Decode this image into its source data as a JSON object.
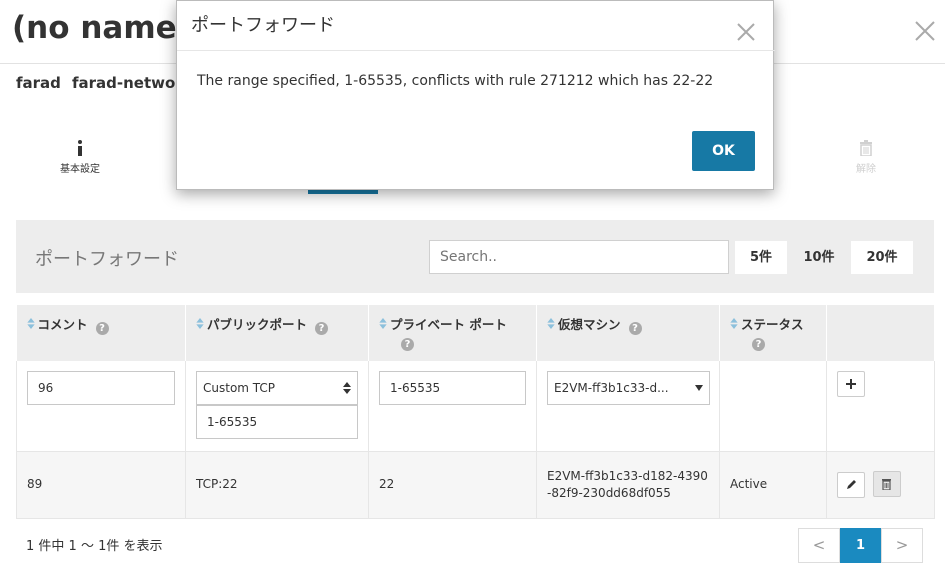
{
  "page": {
    "title": "(no name)",
    "breadcrumbs": [
      "farad",
      "farad-networ"
    ]
  },
  "nav_tabs": [
    {
      "label": "基本設定",
      "icon": "info-icon"
    },
    {
      "label": "解除",
      "icon": "trash-icon"
    }
  ],
  "panel": {
    "title": "ポートフォワード",
    "search_placeholder": "Search..",
    "page_sizes": [
      "5件",
      "10件",
      "20件"
    ],
    "selected_page_size": "10件"
  },
  "table": {
    "columns": [
      "コメント",
      "パブリックポート",
      "プライベート ポート",
      "仮想マシン",
      "ステータス"
    ],
    "edit_row": {
      "comment": "96",
      "protocol": "Custom TCP",
      "public_port": "1-65535",
      "private_port": "1-65535",
      "vm": "E2VM-ff3b1c33-d..."
    },
    "rows": [
      {
        "comment": "89",
        "public": "TCP:22",
        "private": "22",
        "vm": "E2VM-ff3b1c33-d182-4390-82f9-230dd68df055",
        "status": "Active"
      }
    ]
  },
  "footer": {
    "summary": "1 件中 1 〜 1件 を表示",
    "prev": "<",
    "current_page": "1",
    "next": ">"
  },
  "modal": {
    "title": "ポートフォワード",
    "message": "The range specified, 1-65535, conflicts with rule 271212 which has 22-22",
    "ok_label": "OK"
  },
  "colors": {
    "accent": "#1779a5",
    "active_status": "#5a9a3a",
    "panel_bg": "#ededed"
  }
}
